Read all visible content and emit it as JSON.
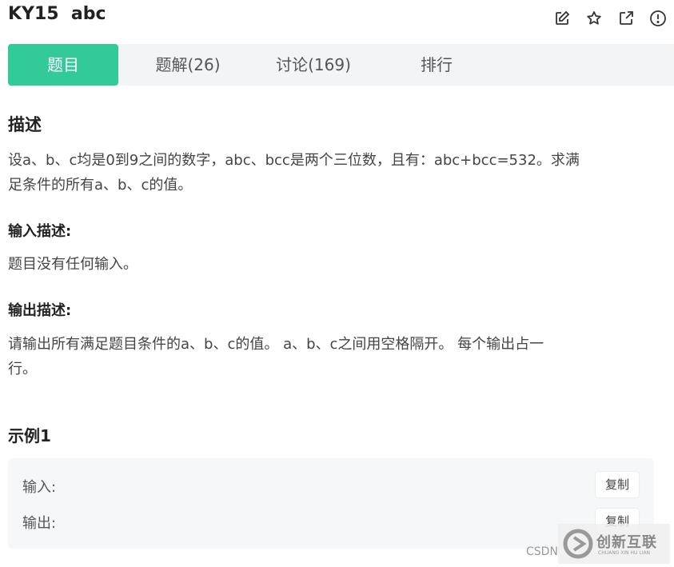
{
  "header": {
    "title": "KY15  abc",
    "icons": [
      "edit-icon",
      "star-icon",
      "external-link-icon",
      "report-icon"
    ]
  },
  "tabs": [
    {
      "label": "题目",
      "active": true
    },
    {
      "label": "题解(26)",
      "active": false
    },
    {
      "label": "讨论(169)",
      "active": false
    },
    {
      "label": "排行",
      "active": false
    }
  ],
  "description": {
    "heading": "描述",
    "line1": "设a、b、c均是0到9之间的数字，abc、bcc是两个三位数，且有：abc+bcc=532。求满",
    "line2": "足条件的所有a、b、c的值。"
  },
  "input_desc": {
    "heading": "输入描述:",
    "text": "题目没有任何输入。"
  },
  "output_desc": {
    "heading": "输出描述:",
    "line1": "请输出所有满足题目条件的a、b、c的值。 a、b、c之间用空格隔开。 每个输出占一",
    "line2": "行。"
  },
  "example": {
    "heading": "示例1",
    "input_label": "输入:",
    "output_label": "输出:",
    "copy_label": "复制"
  },
  "watermark": {
    "csdn": "CSDN",
    "brand": "创新互联",
    "brand_sub": "CHUANG XIN HU LIAN"
  },
  "colors": {
    "accent": "#32ca99",
    "tab_bar": "#f3f4f6",
    "example_bg": "#f6f7f8"
  }
}
